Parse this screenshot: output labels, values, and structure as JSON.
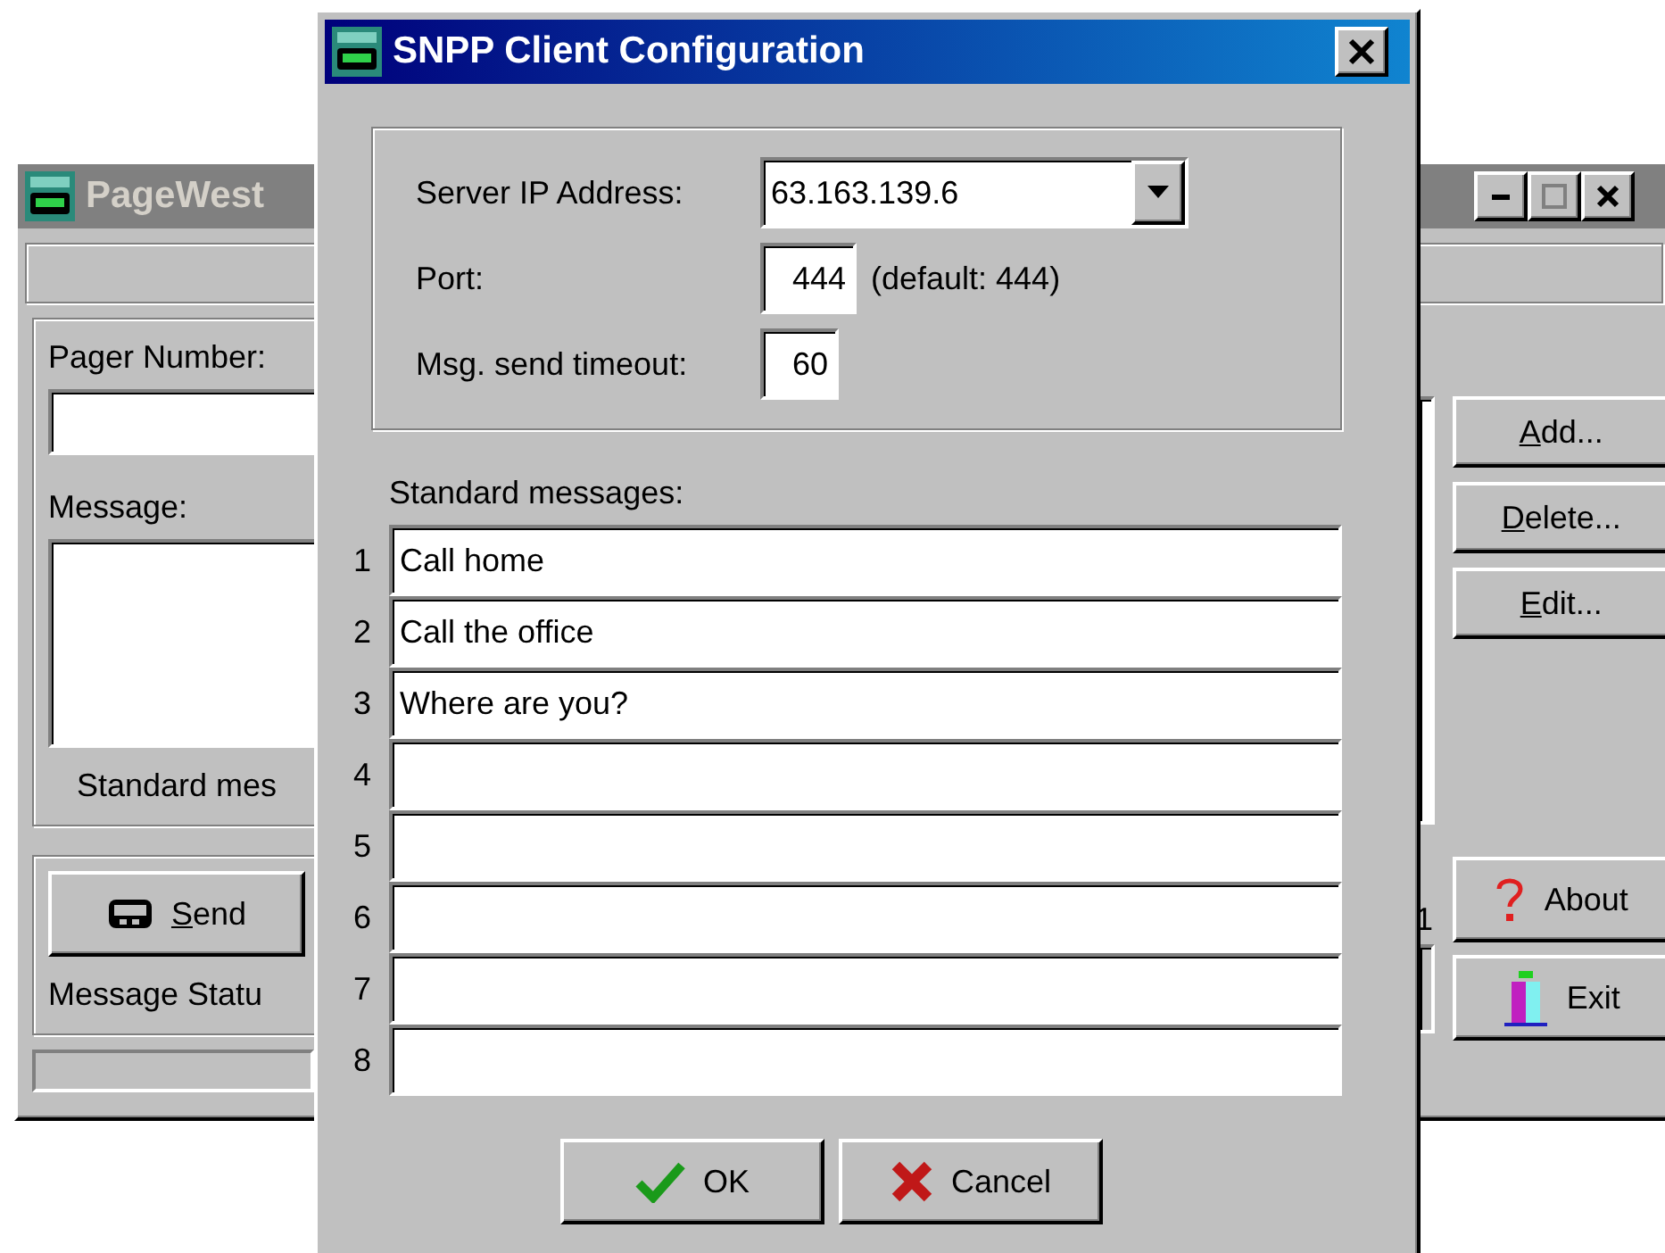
{
  "main_window": {
    "title": "PageWest",
    "pager_number_label": "Pager Number:",
    "message_label": "Message:",
    "standard_label": "Standard mes",
    "send_button": {
      "label": "Send",
      "mnemonic": true
    },
    "status_label": "Message Statu",
    "side_buttons": [
      {
        "label": "Add...",
        "mnemonic": true
      },
      {
        "label": "Delete...",
        "mnemonic": true
      },
      {
        "label": "Edit...",
        "mnemonic": true
      }
    ],
    "lower_buttons": [
      {
        "label": "About",
        "kind": "about"
      },
      {
        "label": "Exit",
        "kind": "exit"
      }
    ],
    "count": "1"
  },
  "dialog": {
    "title": "SNPP Client Configuration",
    "server_label": "Server IP Address:",
    "server_value": "63.163.139.6",
    "port_label": "Port:",
    "port_value": "444",
    "port_hint": "(default: 444)",
    "timeout_label": "Msg. send timeout:",
    "timeout_value": "60",
    "messages_label": "Standard messages:",
    "messages": [
      {
        "number": "1",
        "text": "Call home"
      },
      {
        "number": "2",
        "text": "Call the office"
      },
      {
        "number": "3",
        "text": "Where are you?"
      },
      {
        "number": "4"
      },
      {
        "number": "5"
      },
      {
        "number": "6"
      },
      {
        "number": "7"
      },
      {
        "number": "8"
      }
    ],
    "buttons": [
      {
        "label": "OK",
        "kind": "ok"
      },
      {
        "label": "Cancel",
        "kind": "cancel"
      }
    ]
  }
}
